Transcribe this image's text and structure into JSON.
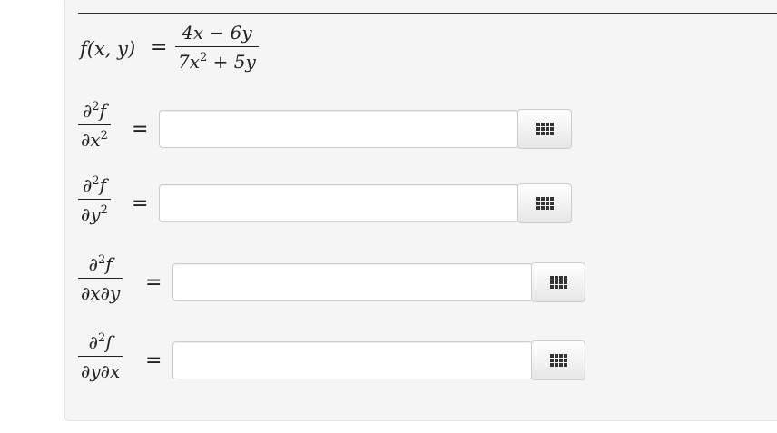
{
  "function": {
    "lhs": "f(x, y)",
    "equals": "=",
    "numerator": "4x − 6y",
    "denominator_base": "7x",
    "denominator_exp": "2",
    "denominator_rest": " + 5y"
  },
  "rows": [
    {
      "num": "∂",
      "num_exp": "2",
      "num_var": "f",
      "den": "∂x",
      "den_exp": "2",
      "den_extra": "",
      "equals": "=",
      "value": "",
      "keypad_icon": "grid-icon"
    },
    {
      "num": "∂",
      "num_exp": "2",
      "num_var": "f",
      "den": "∂y",
      "den_exp": "2",
      "den_extra": "",
      "equals": "=",
      "value": "",
      "keypad_icon": "grid-icon"
    },
    {
      "num": "∂",
      "num_exp": "2",
      "num_var": "f",
      "den": "∂x∂y",
      "den_exp": "",
      "den_extra": "",
      "equals": "=",
      "value": "",
      "keypad_icon": "grid-icon"
    },
    {
      "num": "∂",
      "num_exp": "2",
      "num_var": "f",
      "den": "∂y∂x",
      "den_exp": "",
      "den_extra": "",
      "equals": "=",
      "value": "",
      "keypad_icon": "grid-icon"
    }
  ]
}
